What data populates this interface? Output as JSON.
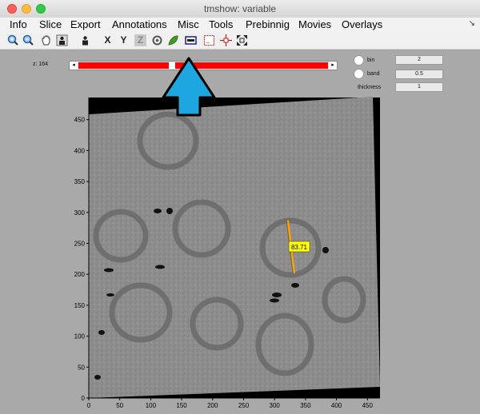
{
  "window": {
    "title": "tmshow: variable"
  },
  "menu": {
    "items": [
      "Info",
      "Slice",
      "Export",
      "Annotations",
      "Misc",
      "Tools",
      "Prebinnig",
      "Movies",
      "Overlays"
    ]
  },
  "toolbar": {
    "tools": [
      {
        "icon": "zoom-in-icon"
      },
      {
        "icon": "zoom-out-icon"
      },
      {
        "icon": "pan-hand-icon"
      },
      {
        "icon": "figure-icon"
      },
      {
        "icon": "figure-alt-icon"
      },
      {
        "icon": "x-axis-icon",
        "label": "X"
      },
      {
        "icon": "y-axis-icon",
        "label": "Y"
      },
      {
        "icon": "z-axis-icon",
        "label": "Z"
      },
      {
        "icon": "rotate-icon"
      },
      {
        "icon": "leaf-icon"
      },
      {
        "icon": "ruler-icon"
      },
      {
        "icon": "selection-icon"
      },
      {
        "icon": "crosshair-icon"
      },
      {
        "icon": "fit-window-icon"
      }
    ]
  },
  "controls": {
    "z_label": "z: 164",
    "slider_left_arrow": "◂",
    "slider_right_arrow": "▸",
    "slider_fraction": 0.37,
    "bin": {
      "label": "bin",
      "value": "2"
    },
    "band": {
      "label": "band",
      "value": "0.5"
    },
    "thickness": {
      "label": "thickness",
      "value": "1"
    }
  },
  "image": {
    "x_ticks": [
      "0",
      "50",
      "100",
      "150",
      "200",
      "250",
      "300",
      "350",
      "400",
      "450"
    ],
    "y_ticks": [
      "0",
      "50",
      "100",
      "150",
      "200",
      "250",
      "300",
      "350",
      "400",
      "450"
    ],
    "measurement": "83.71",
    "measurement_color": "#ffa500"
  },
  "colors": {
    "slider": "#ff0000",
    "arrow": "#1ea6e0",
    "label_bg": "#ffff00"
  }
}
